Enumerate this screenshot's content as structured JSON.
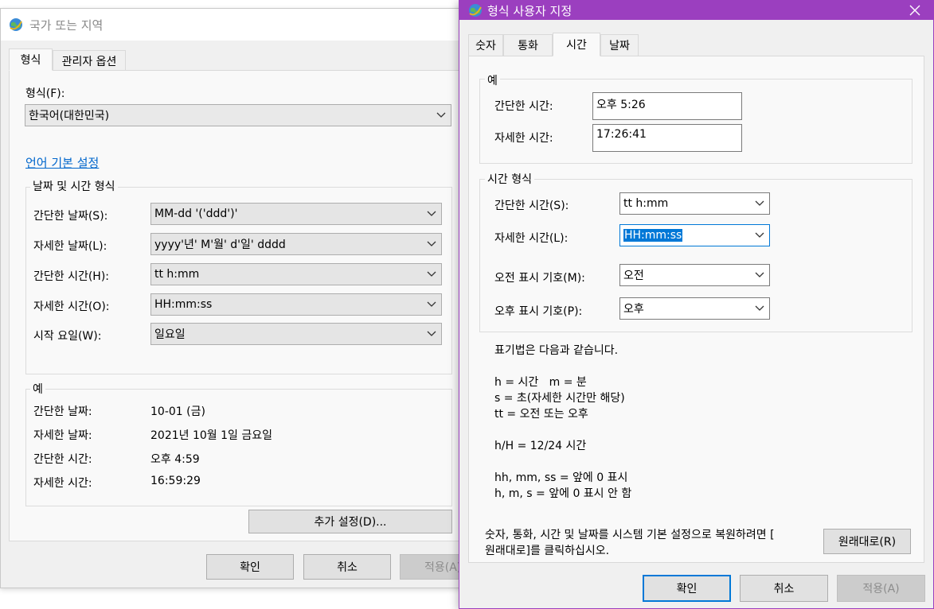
{
  "back_window": {
    "title": "국가 또는 지역",
    "tabs": [
      {
        "label": "형식",
        "active": true
      },
      {
        "label": "관리자 옵션",
        "active": false
      }
    ],
    "format_label": "형식(F):",
    "format_value": "한국어(대한민국)",
    "language_pref_link": "언어 기본 설정",
    "datetime_group": {
      "title": "날짜 및 시간 형식",
      "rows": [
        {
          "label": "간단한 날짜(S):",
          "value": "MM-dd '('ddd')'"
        },
        {
          "label": "자세한 날짜(L):",
          "value": "yyyy'년' M'월' d'일' dddd"
        },
        {
          "label": "간단한 시간(H):",
          "value": "tt h:mm"
        },
        {
          "label": "자세한 시간(O):",
          "value": "HH:mm:ss"
        },
        {
          "label": "시작 요일(W):",
          "value": "일요일"
        }
      ]
    },
    "example_group": {
      "title": "예",
      "rows": [
        {
          "label": "간단한 날짜:",
          "value": "10-01 (금)"
        },
        {
          "label": "자세한 날짜:",
          "value": "2021년 10월 1일 금요일"
        },
        {
          "label": "간단한 시간:",
          "value": "오후 4:59"
        },
        {
          "label": "자세한 시간:",
          "value": "16:59:29"
        }
      ]
    },
    "additional_settings_button": "추가 설정(D)...",
    "ok_button": "확인",
    "cancel_button": "취소",
    "apply_button": "적용(A)"
  },
  "front_window": {
    "title": "형식 사용자 지정",
    "accent_color": "#9b3fbf",
    "tabs": [
      {
        "label": "숫자",
        "active": false
      },
      {
        "label": "통화",
        "active": false
      },
      {
        "label": "시간",
        "active": true
      },
      {
        "label": "날짜",
        "active": false
      }
    ],
    "example_group": {
      "title": "예",
      "short_time_label": "간단한 시간:",
      "short_time_value": "오후 5:26",
      "long_time_label": "자세한 시간:",
      "long_time_value": "17:26:41"
    },
    "time_format_group": {
      "title": "시간 형식",
      "short_time_label": "간단한 시간(S):",
      "short_time_value": "tt h:mm",
      "long_time_label": "자세한 시간(L):",
      "long_time_value": "HH:mm:ss",
      "am_label": "오전 표시 기호(M):",
      "am_value": "오전",
      "pm_label": "오후 표시 기호(P):",
      "pm_value": "오후"
    },
    "notation": [
      "표기법은 다음과 같습니다.",
      "",
      "h = 시간   m = 분",
      "s = 초(자세한 시간만 해당)",
      "tt = 오전 또는 오후",
      "",
      "h/H = 12/24 시간",
      "",
      "hh, mm, ss = 앞에 0 표시",
      "h, m, s = 앞에 0 표시 안 함"
    ],
    "reset_text_line1": "숫자, 통화, 시간 및 날짜를 시스템 기본 설정으로 복원하려면 [",
    "reset_text_line2": "원래대로]를 클릭하십시오.",
    "reset_button": "원래대로(R)",
    "ok_button": "확인",
    "cancel_button": "취소",
    "apply_button": "적용(A)"
  }
}
